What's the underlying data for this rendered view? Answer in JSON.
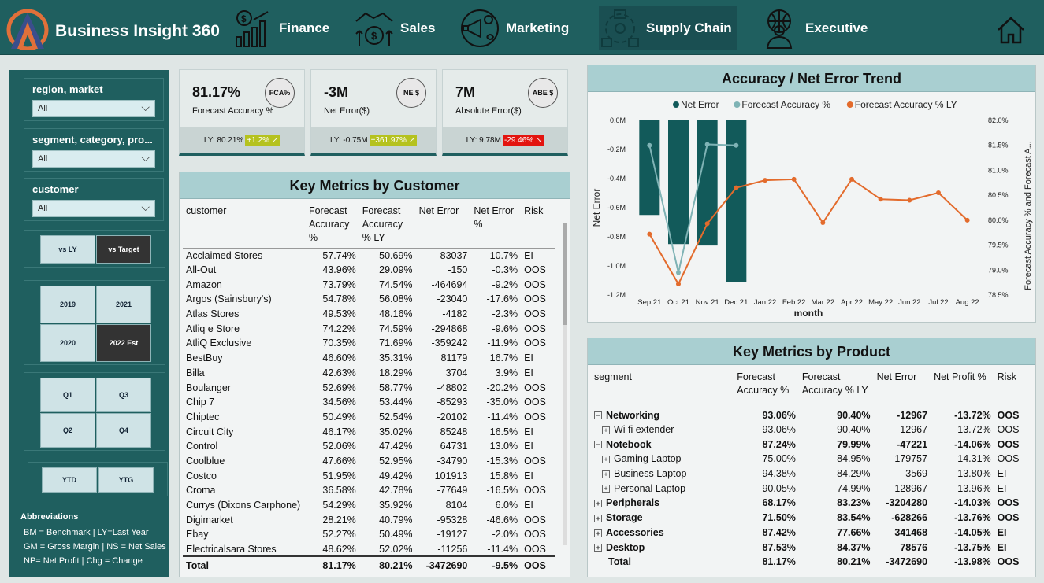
{
  "app": {
    "title": "Business Insight 360"
  },
  "nav": [
    {
      "label": "Finance"
    },
    {
      "label": "Sales"
    },
    {
      "label": "Marketing"
    },
    {
      "label": "Supply Chain"
    },
    {
      "label": "Executive"
    }
  ],
  "filters": [
    {
      "label": "region, market",
      "value": "All"
    },
    {
      "label": "segment, category, pro...",
      "value": "All"
    },
    {
      "label": "customer",
      "value": "All"
    }
  ],
  "compare": [
    "vs LY",
    "vs Target"
  ],
  "years": [
    "2019",
    "2021",
    "2020",
    "2022 Est"
  ],
  "quarters": [
    "Q1",
    "Q3",
    "Q2",
    "Q4"
  ],
  "periods": [
    "YTD",
    "YTG"
  ],
  "abbr": {
    "title": "Abbreviations",
    "lines": [
      "BM = Benchmark | LY=Last Year",
      "GM = Gross Margin | NS = Net Sales",
      "NP= Net Profit | Chg = Change"
    ]
  },
  "kpis": [
    {
      "value": "81.17%",
      "label": "Forecast Accuracy %",
      "badge": "FCA%",
      "ly": "LY: 80.21%",
      "chg": "+1.2% ↗",
      "dir": "up"
    },
    {
      "value": "-3M",
      "label": "Net Error($)",
      "badge": "NE $",
      "ly": "LY: -0.75M",
      "chg": "+361.97% ↗",
      "dir": "up"
    },
    {
      "value": "7M",
      "label": "Absolute Error($)",
      "badge": "ABE $",
      "ly": "LY: 9.78M",
      "chg": "-29.46% ↘",
      "dir": "dn"
    }
  ],
  "customer_table": {
    "title": "Key Metrics by Customer",
    "headers": [
      "customer",
      "Forecast Accuracy %",
      "Forecast Accuracy % LY",
      "Net Error",
      "Net Error %",
      "Risk"
    ],
    "rows": [
      [
        "Acclaimed Stores",
        "57.74%",
        "50.69%",
        "83037",
        "10.7%",
        "EI"
      ],
      [
        "All-Out",
        "43.96%",
        "29.09%",
        "-150",
        "-0.3%",
        "OOS"
      ],
      [
        "Amazon",
        "73.79%",
        "74.54%",
        "-464694",
        "-9.2%",
        "OOS"
      ],
      [
        "Argos (Sainsbury's)",
        "54.78%",
        "56.08%",
        "-23040",
        "-17.6%",
        "OOS"
      ],
      [
        "Atlas Stores",
        "49.53%",
        "48.16%",
        "-4182",
        "-2.3%",
        "OOS"
      ],
      [
        "Atliq e Store",
        "74.22%",
        "74.59%",
        "-294868",
        "-9.6%",
        "OOS"
      ],
      [
        "AtliQ Exclusive",
        "70.35%",
        "71.69%",
        "-359242",
        "-11.9%",
        "OOS"
      ],
      [
        "BestBuy",
        "46.60%",
        "35.31%",
        "81179",
        "16.7%",
        "EI"
      ],
      [
        "Billa",
        "42.63%",
        "18.29%",
        "3704",
        "3.9%",
        "EI"
      ],
      [
        "Boulanger",
        "52.69%",
        "58.77%",
        "-48802",
        "-20.2%",
        "OOS"
      ],
      [
        "Chip 7",
        "34.56%",
        "53.44%",
        "-85293",
        "-35.0%",
        "OOS"
      ],
      [
        "Chiptec",
        "50.49%",
        "52.54%",
        "-20102",
        "-11.4%",
        "OOS"
      ],
      [
        "Circuit City",
        "46.17%",
        "35.02%",
        "85248",
        "16.5%",
        "EI"
      ],
      [
        "Control",
        "52.06%",
        "47.42%",
        "64731",
        "13.0%",
        "EI"
      ],
      [
        "Coolblue",
        "47.66%",
        "52.95%",
        "-34790",
        "-15.3%",
        "OOS"
      ],
      [
        "Costco",
        "51.95%",
        "49.42%",
        "101913",
        "15.8%",
        "EI"
      ],
      [
        "Croma",
        "36.58%",
        "42.78%",
        "-77649",
        "-16.5%",
        "OOS"
      ],
      [
        "Currys (Dixons Carphone)",
        "54.29%",
        "35.92%",
        "8104",
        "6.0%",
        "EI"
      ],
      [
        "Digimarket",
        "28.21%",
        "40.79%",
        "-95328",
        "-46.6%",
        "OOS"
      ],
      [
        "Ebay",
        "52.27%",
        "50.49%",
        "-19127",
        "-2.0%",
        "OOS"
      ],
      [
        "Electricalsara Stores",
        "48.62%",
        "52.02%",
        "-11256",
        "-11.4%",
        "OOS"
      ]
    ],
    "total": [
      "Total",
      "81.17%",
      "80.21%",
      "-3472690",
      "-9.5%",
      "OOS"
    ]
  },
  "product_table": {
    "title": "Key Metrics by Product",
    "headers": [
      "segment",
      "Forecast Accuracy %",
      "Forecast Accuracy % LY",
      "Net Error",
      "Net Profit %",
      "Risk"
    ],
    "rows": [
      {
        "name": "Networking",
        "level": 0,
        "icon": "minus",
        "v": [
          "93.06%",
          "90.40%",
          "-12967",
          "-13.72%",
          "OOS"
        ]
      },
      {
        "name": "Wi fi extender",
        "level": 1,
        "icon": "plus",
        "v": [
          "93.06%",
          "90.40%",
          "-12967",
          "-13.72%",
          "OOS"
        ]
      },
      {
        "name": "Notebook",
        "level": 0,
        "icon": "minus",
        "v": [
          "87.24%",
          "79.99%",
          "-47221",
          "-14.06%",
          "OOS"
        ]
      },
      {
        "name": "Gaming Laptop",
        "level": 1,
        "icon": "plus",
        "v": [
          "75.00%",
          "84.95%",
          "-179757",
          "-14.31%",
          "OOS"
        ]
      },
      {
        "name": "Business Laptop",
        "level": 1,
        "icon": "plus",
        "v": [
          "94.38%",
          "84.29%",
          "3569",
          "-13.80%",
          "EI"
        ]
      },
      {
        "name": "Personal Laptop",
        "level": 1,
        "icon": "plus",
        "v": [
          "90.05%",
          "74.99%",
          "128967",
          "-13.96%",
          "EI"
        ]
      },
      {
        "name": "Peripherals",
        "level": 0,
        "icon": "plus",
        "v": [
          "68.17%",
          "83.23%",
          "-3204280",
          "-14.03%",
          "OOS"
        ]
      },
      {
        "name": "Storage",
        "level": 0,
        "icon": "plus",
        "v": [
          "71.50%",
          "83.54%",
          "-628266",
          "-13.76%",
          "OOS"
        ]
      },
      {
        "name": "Accessories",
        "level": 0,
        "icon": "plus",
        "v": [
          "87.42%",
          "77.66%",
          "341468",
          "-14.05%",
          "EI"
        ]
      },
      {
        "name": "Desktop",
        "level": 0,
        "icon": "plus",
        "v": [
          "87.53%",
          "84.37%",
          "78576",
          "-13.75%",
          "EI"
        ]
      }
    ],
    "total": [
      "Total",
      "81.17%",
      "80.21%",
      "-3472690",
      "-13.98%",
      "OOS"
    ]
  },
  "chart_data": {
    "type": "bar",
    "title": "Accuracy / Net Error Trend",
    "xlabel": "month",
    "ylabel": "Net Error",
    "y2label": "Forecast Accuracy % and Forecast A...",
    "categories": [
      "Sep 21",
      "Oct 21",
      "Nov 21",
      "Dec 21",
      "Jan 22",
      "Feb 22",
      "Mar 22",
      "Apr 22",
      "May 22",
      "Jun 22",
      "Jul 22",
      "Aug 22"
    ],
    "legend": [
      "Net Error",
      "Forecast Accuracy %",
      "Forecast Accuracy % LY"
    ],
    "series": [
      {
        "name": "Net Error",
        "type": "bar",
        "axis": "left",
        "color": "#125a5a",
        "values": [
          -0.65,
          -0.85,
          -0.86,
          -1.11,
          null,
          null,
          null,
          null,
          null,
          null,
          null,
          null
        ]
      },
      {
        "name": "Forecast Accuracy %",
        "type": "line",
        "axis": "right",
        "color": "#7fb3b5",
        "values": [
          81.5,
          78.95,
          81.52,
          81.5,
          null,
          null,
          null,
          null,
          null,
          null,
          null,
          null
        ]
      },
      {
        "name": "Forecast Accuracy % LY",
        "type": "line",
        "axis": "right",
        "color": "#e36b2c",
        "values": [
          79.72,
          78.72,
          79.93,
          80.65,
          80.8,
          80.82,
          79.95,
          80.82,
          80.42,
          80.4,
          80.55,
          80.0
        ]
      }
    ],
    "ylim": [
      -1.2,
      0
    ],
    "y2lim": [
      78.5,
      82.0
    ],
    "yticks": [
      "0.0M",
      "-0.2M",
      "-0.4M",
      "-0.6M",
      "-0.8M",
      "-1.0M",
      "-1.2M"
    ],
    "y2ticks": [
      "82.0%",
      "81.5%",
      "81.0%",
      "80.5%",
      "80.0%",
      "79.5%",
      "79.0%",
      "78.5%"
    ]
  }
}
